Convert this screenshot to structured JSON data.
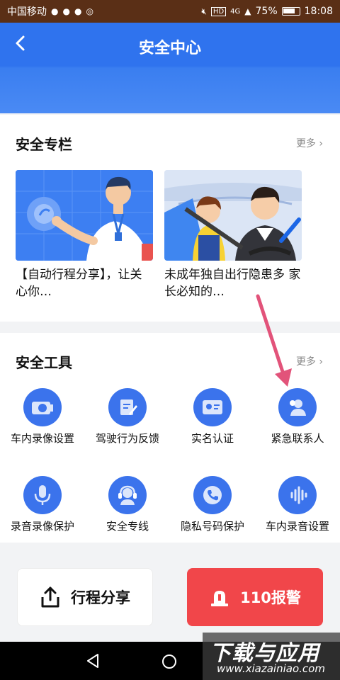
{
  "status_bar": {
    "carrier": "中国移动",
    "network": "4G",
    "battery": "75%",
    "time": "18:08"
  },
  "header": {
    "title": "安全中心"
  },
  "column": {
    "title": "安全专栏",
    "more": "更多",
    "articles": [
      {
        "caption": "【自动行程分享】，让关心你…"
      },
      {
        "caption": "未成年独自出行隐患多 家长必知的…"
      }
    ]
  },
  "tools": {
    "title": "安全工具",
    "more": "更多",
    "items": [
      {
        "label": "车内录像设置",
        "icon": "camera-icon"
      },
      {
        "label": "驾驶行为反馈",
        "icon": "feedback-edit-icon"
      },
      {
        "label": "实名认证",
        "icon": "id-card-icon"
      },
      {
        "label": "紧急联系人",
        "icon": "emergency-contact-icon"
      },
      {
        "label": "录音录像保护",
        "icon": "microphone-icon"
      },
      {
        "label": "安全专线",
        "icon": "headset-icon"
      },
      {
        "label": "隐私号码保护",
        "icon": "phone-icon"
      },
      {
        "label": "车内录音设置",
        "icon": "sound-wave-icon"
      }
    ]
  },
  "actions": {
    "share": "行程分享",
    "alarm": "110报警"
  },
  "watermark": {
    "line1": "下载与应用",
    "line2": "www.xiazainiao.com"
  },
  "colors": {
    "header_blue": "#2f73ee",
    "icon_blue": "#3b73ec",
    "alarm_red": "#f1464a",
    "arrow_pink": "#e2537a"
  }
}
